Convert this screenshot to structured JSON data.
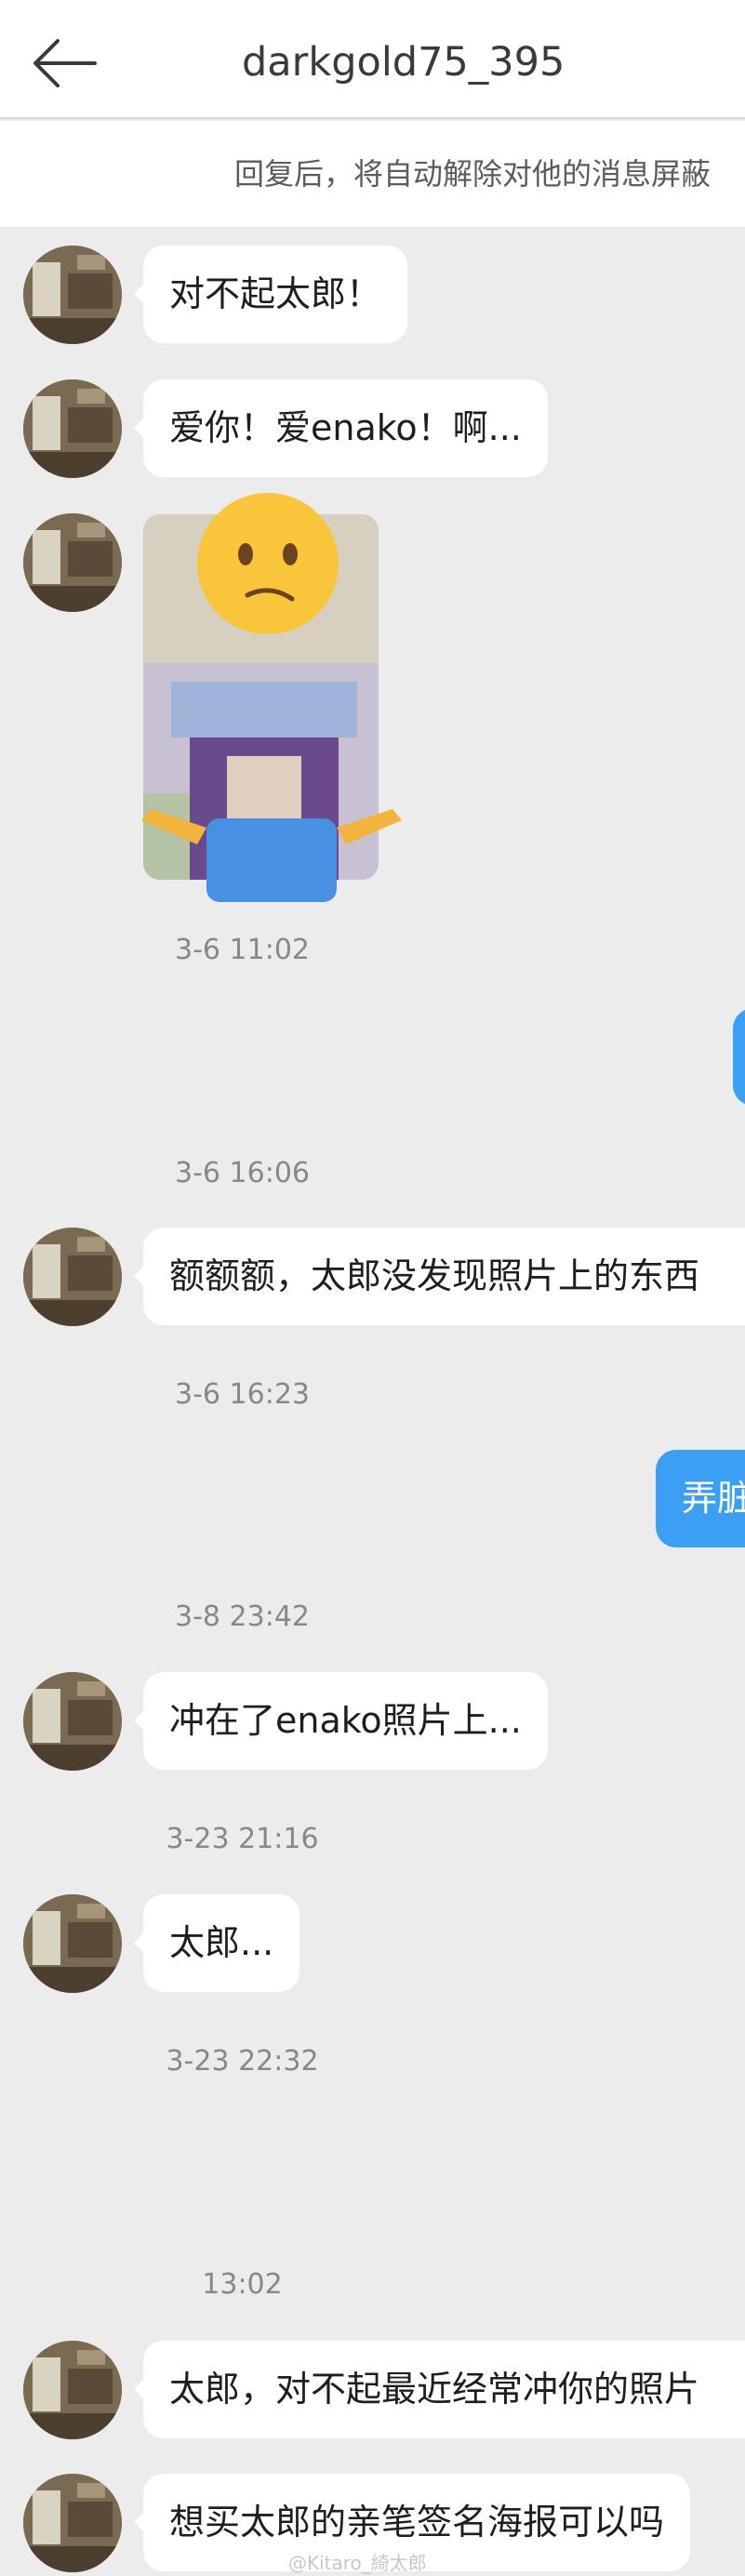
{
  "header": {
    "title": "darkgold75_395",
    "back_icon": "arrow-left-icon"
  },
  "notice": {
    "text": "回复后，将自动解除对他的消息屏蔽"
  },
  "messages": [
    {
      "kind": "in",
      "text": "对不起太郎！"
    },
    {
      "kind": "in",
      "text": "爱你！爱enako！啊..."
    },
    {
      "kind": "in-image",
      "icon": "shrug-emoji-sticker"
    },
    {
      "kind": "time",
      "text": "3-6 11:02"
    },
    {
      "kind": "out",
      "text": ""
    },
    {
      "kind": "time",
      "text": "3-6 16:06"
    },
    {
      "kind": "in",
      "text": "额额额，太郎没发现照片上的东西"
    },
    {
      "kind": "time",
      "text": "3-6 16:23"
    },
    {
      "kind": "out",
      "text": "弄脏"
    },
    {
      "kind": "time",
      "text": "3-8 23:42"
    },
    {
      "kind": "in",
      "text": "冲在了enako照片上..."
    },
    {
      "kind": "time",
      "text": "3-23 21:16"
    },
    {
      "kind": "in",
      "text": "太郎..."
    },
    {
      "kind": "time",
      "text": "3-23 22:32"
    },
    {
      "kind": "time",
      "text": "13:02"
    },
    {
      "kind": "in",
      "text": "太郎，对不起最近经常冲你的照片"
    },
    {
      "kind": "in",
      "text": "想买太郎的亲笔签名海报可以吗"
    }
  ],
  "watermark": "@Kitaro_綺太郎",
  "colors": {
    "header_bg": "#ffffff",
    "chat_bg": "#ececec",
    "incoming_bubble": "#ffffff",
    "outgoing_bubble": "#3b9ff3",
    "timestamp_text": "#888888"
  }
}
